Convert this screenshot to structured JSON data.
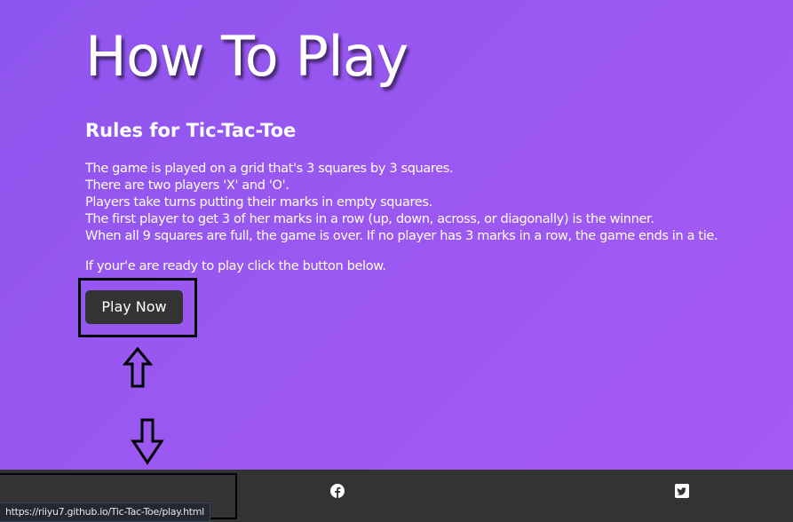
{
  "page": {
    "title": "How To Play",
    "rules_heading": "Rules for Tic-Tac-Toe",
    "rules": [
      "The game is played on a grid that's 3 squares by 3 squares.",
      "There are two players 'X' and 'O'.",
      "Players take turns putting their marks in empty squares.",
      "The first player to get 3 of her marks in a row (up, down, across, or diagonally) is the winner.",
      "When all 9 squares are full, the game is over. If no player has 3 marks in a row, the game ends in a tie."
    ],
    "cta_text": "If your'e are ready to play click the button below.",
    "play_button_label": "Play Now"
  },
  "footer": {
    "icons": [
      "facebook-icon",
      "twitter-icon"
    ]
  },
  "status_bar": {
    "url": "https://riiyu7.github.io/Tic-Tac-Toe/play.html"
  },
  "annotations": {
    "arrows": [
      "up-arrow-icon",
      "down-arrow-icon"
    ],
    "box_color": "#000000"
  },
  "colors": {
    "background_start": "#8d55ee",
    "background_end": "#a65af3",
    "button": "#333333",
    "footer": "#333333"
  }
}
